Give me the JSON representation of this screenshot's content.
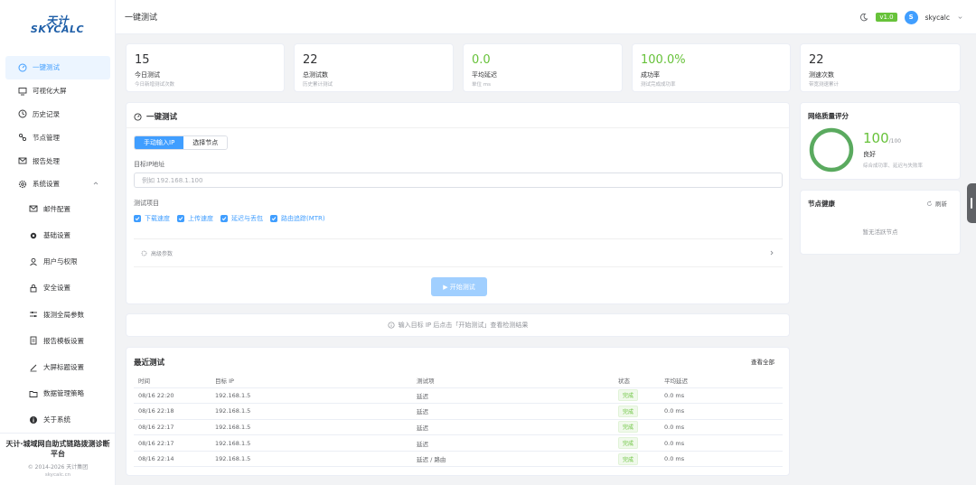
{
  "logo": {
    "line1": "天计",
    "line2": "SKYCALC"
  },
  "sidebar": {
    "items": [
      {
        "label": "一键测试",
        "icon": "gauge-icon"
      },
      {
        "label": "可视化大屏",
        "icon": "monitor-icon"
      },
      {
        "label": "历史记录",
        "icon": "clock-icon"
      },
      {
        "label": "节点管理",
        "icon": "node-icon"
      },
      {
        "label": "报告处理",
        "icon": "mail-icon"
      },
      {
        "label": "系统设置",
        "icon": "gear-icon"
      }
    ],
    "sub_items": [
      {
        "label": "邮件配置",
        "icon": "mail-icon"
      },
      {
        "label": "基础设置",
        "icon": "gear-icon"
      },
      {
        "label": "用户与权限",
        "icon": "user-icon"
      },
      {
        "label": "安全设置",
        "icon": "lock-icon"
      },
      {
        "label": "拨测全局参数",
        "icon": "sliders-icon"
      },
      {
        "label": "报告模板设置",
        "icon": "document-icon"
      },
      {
        "label": "大屏标题设置",
        "icon": "pen-icon"
      },
      {
        "label": "数据管理策略",
        "icon": "folder-icon"
      },
      {
        "label": "关于系统",
        "icon": "info-icon"
      }
    ],
    "footer": {
      "title": "天计·城域网自助式链路拨测诊断平台",
      "copyright": "© 2014-2026 天计集团",
      "domain": "skycalc.cn"
    }
  },
  "header": {
    "title": "一键测试",
    "version": "v1.0",
    "avatar_letter": "S",
    "username": "skycalc"
  },
  "stats": [
    {
      "value": "15",
      "label": "今日测试",
      "sub": "今日新增测试次数",
      "color": "normal"
    },
    {
      "value": "22",
      "label": "总测试数",
      "sub": "历史累计测试",
      "color": "normal"
    },
    {
      "value": "0.0",
      "label": "平均延迟",
      "sub": "单位 ms",
      "color": "green"
    },
    {
      "value": "100.0%",
      "label": "成功率",
      "sub": "测试完成成功率",
      "color": "green"
    },
    {
      "value": "22",
      "label": "测速次数",
      "sub": "带宽测速累计",
      "color": "normal"
    }
  ],
  "test_panel": {
    "title": "一键测试",
    "tabs": [
      "手动输入IP",
      "选择节点"
    ],
    "ip_label": "目标IP地址",
    "ip_placeholder": "例如 192.168.1.100",
    "items_label": "测试项目",
    "items": [
      "下载速度",
      "上传速度",
      "延迟与丢包",
      "路由追踪(MTR)"
    ],
    "advanced": "高级参数",
    "start": "▶ 开始测试"
  },
  "hint": "输入目标 IP 后点击「开始测试」查看检测结果",
  "recent": {
    "title": "最近测试",
    "view_all": "查看全部",
    "columns": [
      "时间",
      "目标 IP",
      "测试项",
      "状态",
      "平均延迟"
    ],
    "rows": [
      {
        "time": "08/16 22:20",
        "ip": "192.168.1.5",
        "item": "延迟",
        "status": "完成",
        "latency": "0.0 ms"
      },
      {
        "time": "08/16 22:18",
        "ip": "192.168.1.5",
        "item": "延迟",
        "status": "完成",
        "latency": "0.0 ms"
      },
      {
        "time": "08/16 22:17",
        "ip": "192.168.1.5",
        "item": "延迟",
        "status": "完成",
        "latency": "0.0 ms"
      },
      {
        "time": "08/16 22:17",
        "ip": "192.168.1.5",
        "item": "延迟",
        "status": "完成",
        "latency": "0.0 ms"
      },
      {
        "time": "08/16 22:14",
        "ip": "192.168.1.5",
        "item": "延迟 / 路由",
        "status": "完成",
        "latency": "0.0 ms"
      }
    ]
  },
  "quality": {
    "title": "网络质量评分",
    "score": "100",
    "max": "/100",
    "grade": "良好",
    "desc": "综合成功率、延迟与失败率",
    "ring_color": "#5aaa5f"
  },
  "node_health": {
    "title": "节点健康",
    "refresh": "刷新",
    "empty": "暂无活跃节点"
  }
}
